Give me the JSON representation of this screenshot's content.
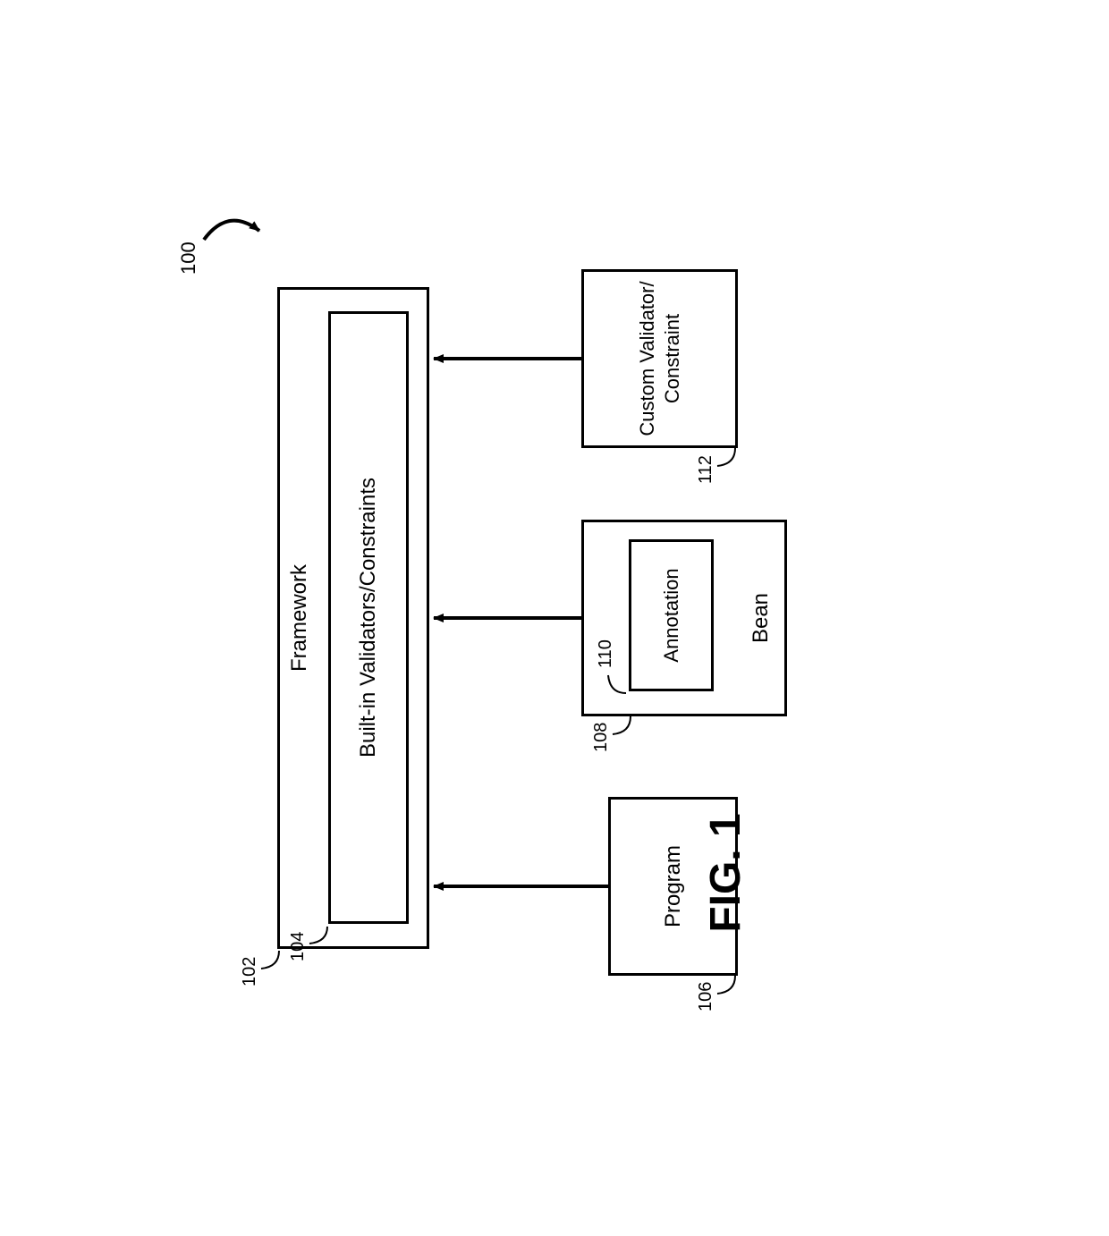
{
  "figure_label": "FIG. 1",
  "system_ref": "100",
  "framework": {
    "label": "Framework",
    "ref": "102"
  },
  "builtin": {
    "label": "Built-in Validators/Constraints",
    "ref": "104"
  },
  "program": {
    "label": "Program",
    "ref": "106"
  },
  "bean": {
    "label": "Bean",
    "ref": "108"
  },
  "annotation": {
    "label": "Annotation",
    "ref": "110"
  },
  "custom": {
    "label": "Custom Validator/ Constraint",
    "ref": "112"
  }
}
